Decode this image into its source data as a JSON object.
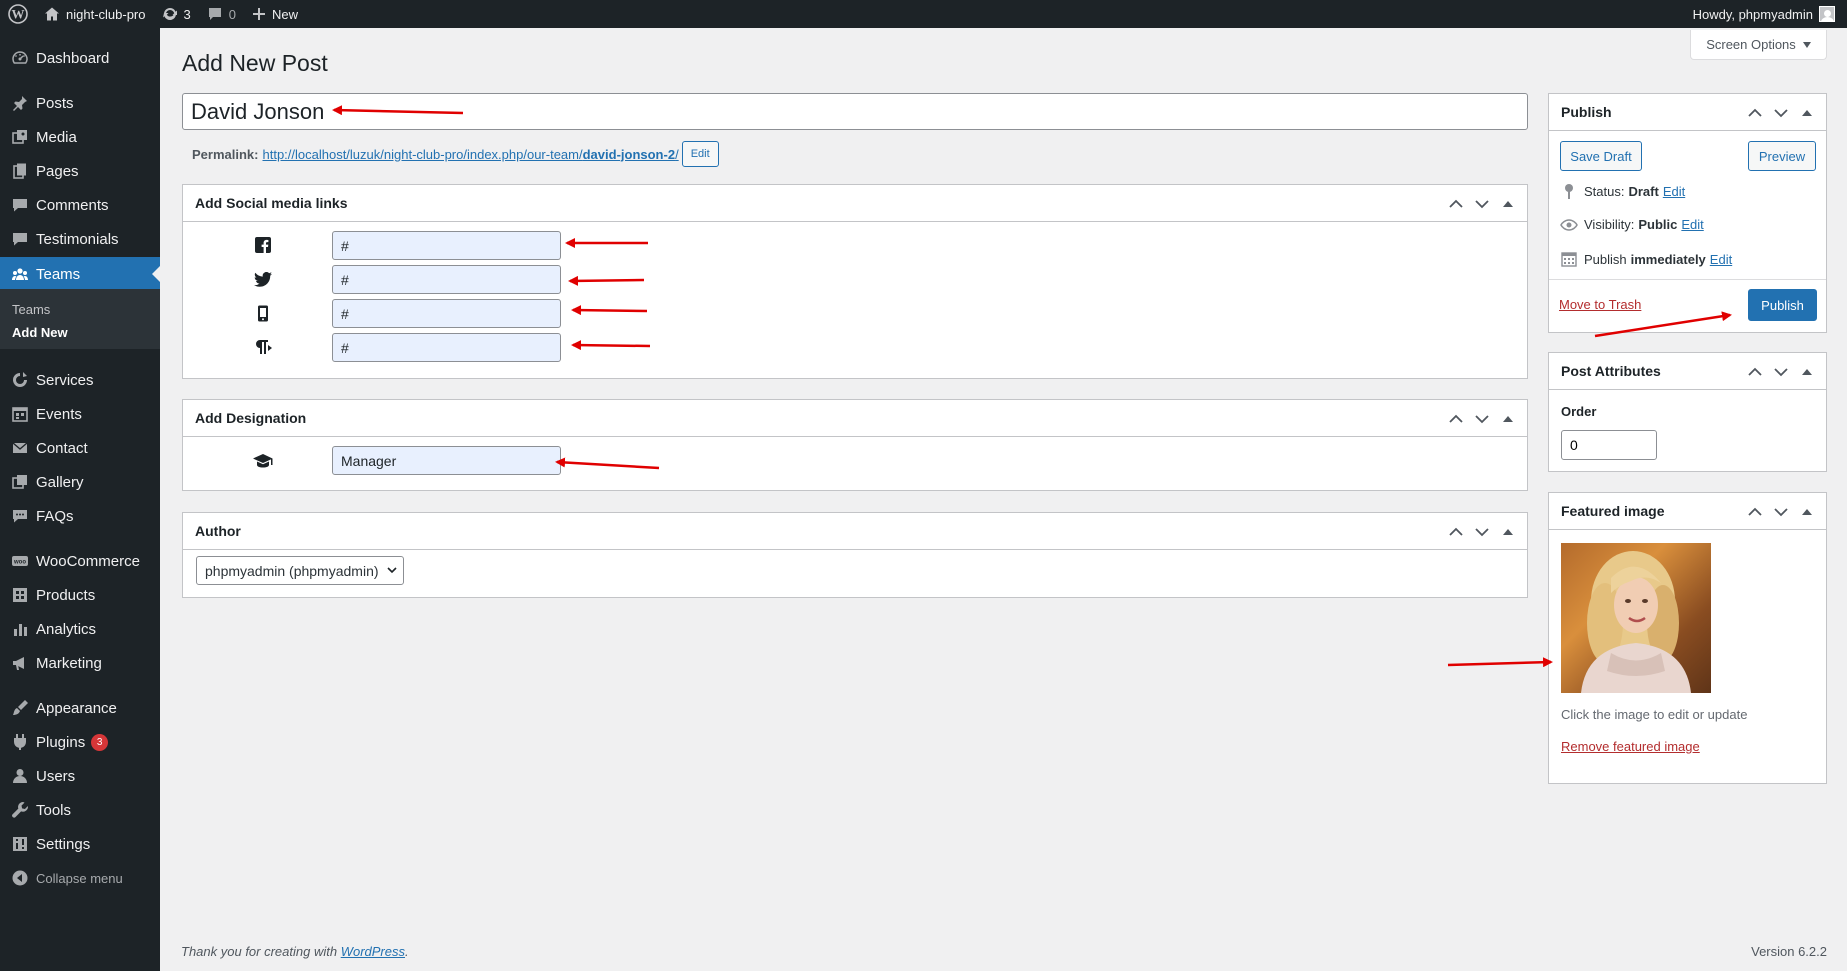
{
  "adminbar": {
    "site_name": "night-club-pro",
    "updates_count": "3",
    "comments_count": "0",
    "new_label": "New",
    "howdy": "Howdy, phpmyadmin"
  },
  "sidebar": {
    "items": [
      {
        "label": "Dashboard",
        "icon": "dashboard-icon"
      },
      {
        "label": "Posts",
        "icon": "pin-icon"
      },
      {
        "label": "Media",
        "icon": "media-icon"
      },
      {
        "label": "Pages",
        "icon": "pages-icon"
      },
      {
        "label": "Comments",
        "icon": "comments-icon"
      },
      {
        "label": "Testimonials",
        "icon": "testimonials-icon"
      },
      {
        "label": "Teams",
        "icon": "teams-icon"
      },
      {
        "label": "Services",
        "icon": "services-icon"
      },
      {
        "label": "Events",
        "icon": "events-icon"
      },
      {
        "label": "Contact",
        "icon": "mail-icon"
      },
      {
        "label": "Gallery",
        "icon": "gallery-icon"
      },
      {
        "label": "FAQs",
        "icon": "faqs-icon"
      },
      {
        "label": "WooCommerce",
        "icon": "woo-icon"
      },
      {
        "label": "Products",
        "icon": "products-icon"
      },
      {
        "label": "Analytics",
        "icon": "analytics-icon"
      },
      {
        "label": "Marketing",
        "icon": "marketing-icon"
      },
      {
        "label": "Appearance",
        "icon": "brush-icon"
      },
      {
        "label": "Plugins",
        "icon": "plugin-icon",
        "badge": "3"
      },
      {
        "label": "Users",
        "icon": "users-icon"
      },
      {
        "label": "Tools",
        "icon": "tools-icon"
      },
      {
        "label": "Settings",
        "icon": "settings-icon"
      },
      {
        "label": "Collapse menu",
        "icon": "collapse-icon"
      }
    ],
    "submenu": [
      {
        "label": "Teams"
      },
      {
        "label": "Add New"
      }
    ]
  },
  "header": {
    "screen_options": "Screen Options",
    "page_title": "Add New Post"
  },
  "post": {
    "title_value": "David Jonson",
    "permalink_label": "Permalink:",
    "permalink_base": "http://localhost/luzuk/night-club-pro/index.php/our-team/",
    "permalink_slug": "david-jonson-2",
    "permalink_trailing": "/",
    "permalink_edit": "Edit"
  },
  "social_box": {
    "title": "Add Social media links",
    "fields": [
      {
        "icon": "facebook-icon",
        "value": "#"
      },
      {
        "icon": "twitter-icon",
        "value": "#"
      },
      {
        "icon": "mobile-icon",
        "value": "#"
      },
      {
        "icon": "paragraph-icon",
        "value": "#"
      }
    ]
  },
  "designation_box": {
    "title": "Add Designation",
    "icon": "graduation-cap-icon",
    "value": "Manager"
  },
  "author_box": {
    "title": "Author",
    "selected": "phpmyadmin (phpmyadmin)"
  },
  "publish_box": {
    "title": "Publish",
    "save_draft": "Save Draft",
    "preview": "Preview",
    "status_label": "Status:",
    "status_value": "Draft",
    "visibility_label": "Visibility:",
    "visibility_value": "Public",
    "publish_label": "Publish",
    "publish_value": "immediately",
    "edit": "Edit",
    "move_to_trash": "Move to Trash",
    "publish_button": "Publish"
  },
  "attributes_box": {
    "title": "Post Attributes",
    "order_label": "Order",
    "order_value": "0"
  },
  "featured_box": {
    "title": "Featured image",
    "hint": "Click the image to edit or update",
    "remove": "Remove featured image"
  },
  "footer": {
    "thanks_prefix": "Thank you for creating with ",
    "wordpress": "WordPress",
    "thanks_suffix": ".",
    "version": "Version 6.2.2"
  },
  "colors": {
    "admin_dark": "#1d2327",
    "accent": "#2271b1",
    "annotation_arrow": "#e00000"
  }
}
